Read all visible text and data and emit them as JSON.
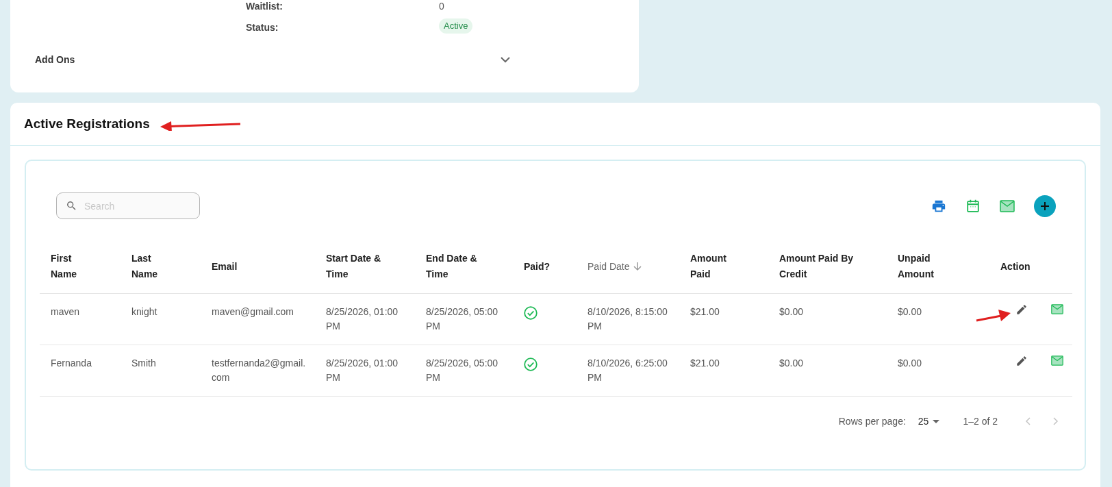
{
  "event_card": {
    "fields": [
      {
        "kind": "text",
        "label": "Waitlist:",
        "value": "0"
      },
      {
        "kind": "badge",
        "label": "Status:",
        "value": "Active"
      }
    ],
    "add_ons": {
      "label": "Add Ons",
      "expanded": false
    }
  },
  "registrations": {
    "title": "Active Registrations",
    "search": {
      "placeholder": "Search"
    },
    "columns": [
      {
        "label": "First Name",
        "sorted": false
      },
      {
        "label": "Last Name",
        "sorted": false
      },
      {
        "label": "Email",
        "sorted": false
      },
      {
        "label": "Start Date & Time",
        "sorted": false
      },
      {
        "label": "End Date & Time",
        "sorted": false
      },
      {
        "label": "Paid?",
        "sorted": false
      },
      {
        "label": "Paid Date",
        "sorted": true
      },
      {
        "label": "Amount Paid",
        "sorted": false
      },
      {
        "label": "Amount Paid By Credit",
        "sorted": false
      },
      {
        "label": "Unpaid Amount",
        "sorted": false
      },
      {
        "label": "Action",
        "sorted": false
      }
    ],
    "rows": [
      {
        "first_name": "maven",
        "last_name": "knight",
        "email": "maven@gmail.com",
        "start": "8/25/2026, 01:00 PM",
        "end": "8/25/2026, 05:00 PM",
        "paid": true,
        "paid_date": "8/10/2026, 8:15:00 PM",
        "amount_paid": "$21.00",
        "paid_by_credit": "$0.00",
        "unpaid": "$0.00"
      },
      {
        "first_name": "Fernanda",
        "last_name": "Smith",
        "email": "testfernanda2@gmail.com",
        "start": "8/25/2026, 01:00 PM",
        "end": "8/25/2026, 05:00 PM",
        "paid": true,
        "paid_date": "8/10/2026, 6:25:00 PM",
        "amount_paid": "$21.00",
        "paid_by_credit": "$0.00",
        "unpaid": "$0.00"
      }
    ],
    "pagination": {
      "rows_per_page_label": "Rows per page:",
      "rows_per_page": "25",
      "range": "1–2 of 2",
      "prev_disabled": true,
      "next_disabled": true
    }
  }
}
